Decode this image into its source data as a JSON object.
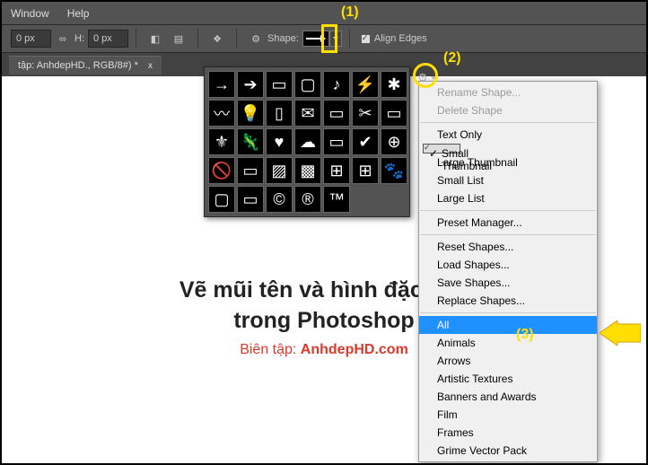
{
  "menubar": {
    "window": "Window",
    "help": "Help"
  },
  "options": {
    "w_val": "0 px",
    "h_label": "H:",
    "h_val": "0 px",
    "shape_label": "Shape:",
    "align_edges": "Align Edges"
  },
  "tab": {
    "title": "tập: AnhdepHD., RGB/8#) *",
    "close": "x"
  },
  "annotations": {
    "n1": "(1)",
    "n2": "(2)",
    "n3": "(3)"
  },
  "caption": {
    "line1": "Vẽ mũi tên và hình đặc biệt",
    "line2": "trong Photoshop",
    "editor_label": "Biên tập: ",
    "editor_site": "AnhdepHD.com"
  },
  "menu": {
    "rename": "Rename Shape...",
    "delete": "Delete Shape",
    "text_only": "Text Only",
    "small_thumb": "Small Thumbnail",
    "large_thumb": "Large Thumbnail",
    "small_list": "Small List",
    "large_list": "Large List",
    "preset_mgr": "Preset Manager...",
    "reset": "Reset Shapes...",
    "load": "Load Shapes...",
    "save": "Save Shapes...",
    "replace": "Replace Shapes...",
    "all": "All",
    "animals": "Animals",
    "arrows": "Arrows",
    "artistic": "Artistic Textures",
    "banners": "Banners and Awards",
    "film": "Film",
    "frames": "Frames",
    "grime": "Grime Vector Pack"
  },
  "shape_icons": [
    "→",
    "➔",
    "▭",
    "▢",
    "♪",
    "⚡",
    "✱",
    "〰",
    "💡",
    "▯",
    "✉",
    "▭",
    "✂",
    "▭",
    "⚜",
    "🦎",
    "♥",
    "☁",
    "▭",
    "✔",
    "⊕",
    "🚫",
    "▭",
    "▨",
    "▩",
    "⊞",
    "⊞",
    "🐾",
    "▢",
    "▭",
    "©",
    "®",
    "™"
  ]
}
